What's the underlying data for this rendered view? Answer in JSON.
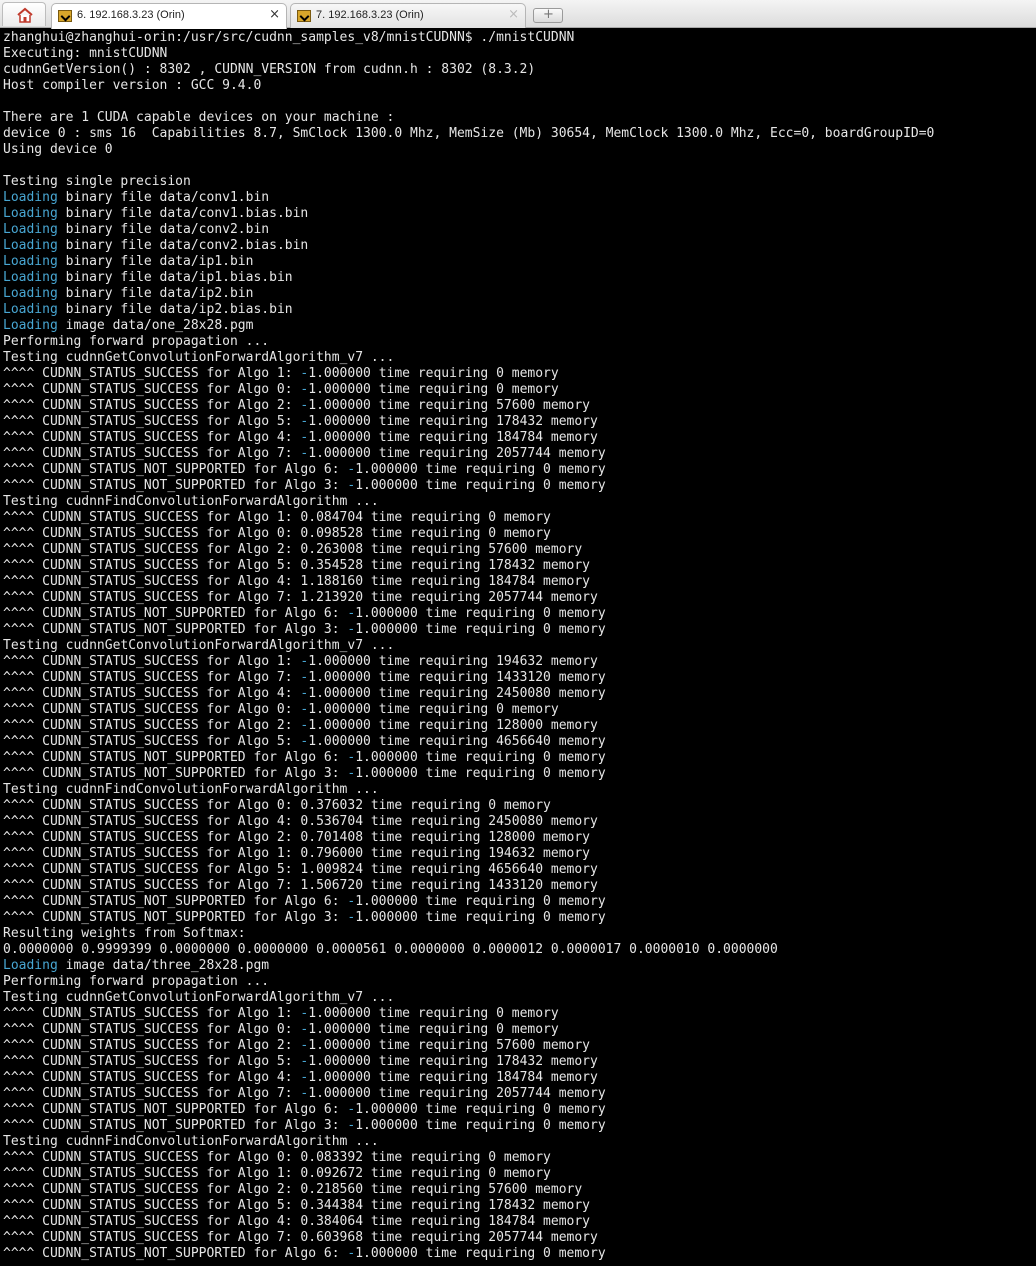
{
  "tabs": [
    {
      "label": "6. 192.168.3.23 (Orin)",
      "close": "×",
      "active": true
    },
    {
      "label": "7. 192.168.3.23 (Orin)",
      "close": "×",
      "active": false
    }
  ],
  "new_tab_symbol": "+",
  "colors": {
    "terminal_bg": "#000000",
    "terminal_fg": "#e6e6e6",
    "highlight": "#48a6d2"
  },
  "terminal": {
    "lines": [
      {
        "t": "zhanghui@zhanghui-orin:/usr/src/cudnn_samples_v8/mnistCUDNN$ ./mnistCUDNN"
      },
      {
        "t": "Executing: mnistCUDNN"
      },
      {
        "t": "cudnnGetVersion() : 8302 , CUDNN_VERSION from cudnn.h : 8302 (8.3.2)"
      },
      {
        "t": "Host compiler version : GCC 9.4.0"
      },
      {
        "t": ""
      },
      {
        "t": "There are 1 CUDA capable devices on your machine :"
      },
      {
        "t": "device 0 : sms 16  Capabilities 8.7, SmClock 1300.0 Mhz, MemSize (Mb) 30654, MemClock 1300.0 Mhz, Ecc=0, boardGroupID=0"
      },
      {
        "t": "Using device 0"
      },
      {
        "t": ""
      },
      {
        "t": "Testing single precision"
      },
      {
        "a": "Loading",
        "b": " binary file data/conv1.bin"
      },
      {
        "a": "Loading",
        "b": " binary file data/conv1.bias.bin"
      },
      {
        "a": "Loading",
        "b": " binary file data/conv2.bin"
      },
      {
        "a": "Loading",
        "b": " binary file data/conv2.bias.bin"
      },
      {
        "a": "Loading",
        "b": " binary file data/ip1.bin"
      },
      {
        "a": "Loading",
        "b": " binary file data/ip1.bias.bin"
      },
      {
        "a": "Loading",
        "b": " binary file data/ip2.bin"
      },
      {
        "a": "Loading",
        "b": " binary file data/ip2.bias.bin"
      },
      {
        "a": "Loading",
        "b": " image data/one_28x28.pgm"
      },
      {
        "t": "Performing forward propagation ..."
      },
      {
        "t": "Testing cudnnGetConvolutionForwardAlgorithm_v7 ..."
      },
      {
        "p": "^^^^ CUDNN_STATUS_SUCCESS for Algo 1: ",
        "h": "-",
        "s": "1.000000 time requiring 0 memory"
      },
      {
        "p": "^^^^ CUDNN_STATUS_SUCCESS for Algo 0: ",
        "h": "-",
        "s": "1.000000 time requiring 0 memory"
      },
      {
        "p": "^^^^ CUDNN_STATUS_SUCCESS for Algo 2: ",
        "h": "-",
        "s": "1.000000 time requiring 57600 memory"
      },
      {
        "p": "^^^^ CUDNN_STATUS_SUCCESS for Algo 5: ",
        "h": "-",
        "s": "1.000000 time requiring 178432 memory"
      },
      {
        "p": "^^^^ CUDNN_STATUS_SUCCESS for Algo 4: ",
        "h": "-",
        "s": "1.000000 time requiring 184784 memory"
      },
      {
        "p": "^^^^ CUDNN_STATUS_SUCCESS for Algo 7: ",
        "h": "-",
        "s": "1.000000 time requiring 2057744 memory"
      },
      {
        "p": "^^^^ CUDNN_STATUS_NOT_SUPPORTED for Algo 6: ",
        "h": "-",
        "s": "1.000000 time requiring 0 memory"
      },
      {
        "p": "^^^^ CUDNN_STATUS_NOT_SUPPORTED for Algo 3: ",
        "h": "-",
        "s": "1.000000 time requiring 0 memory"
      },
      {
        "t": "Testing cudnnFindConvolutionForwardAlgorithm ..."
      },
      {
        "t": "^^^^ CUDNN_STATUS_SUCCESS for Algo 1: 0.084704 time requiring 0 memory"
      },
      {
        "t": "^^^^ CUDNN_STATUS_SUCCESS for Algo 0: 0.098528 time requiring 0 memory"
      },
      {
        "t": "^^^^ CUDNN_STATUS_SUCCESS for Algo 2: 0.263008 time requiring 57600 memory"
      },
      {
        "t": "^^^^ CUDNN_STATUS_SUCCESS for Algo 5: 0.354528 time requiring 178432 memory"
      },
      {
        "t": "^^^^ CUDNN_STATUS_SUCCESS for Algo 4: 1.188160 time requiring 184784 memory"
      },
      {
        "t": "^^^^ CUDNN_STATUS_SUCCESS for Algo 7: 1.213920 time requiring 2057744 memory"
      },
      {
        "p": "^^^^ CUDNN_STATUS_NOT_SUPPORTED for Algo 6: ",
        "h": "-",
        "s": "1.000000 time requiring 0 memory"
      },
      {
        "p": "^^^^ CUDNN_STATUS_NOT_SUPPORTED for Algo 3: ",
        "h": "-",
        "s": "1.000000 time requiring 0 memory"
      },
      {
        "t": "Testing cudnnGetConvolutionForwardAlgorithm_v7 ..."
      },
      {
        "p": "^^^^ CUDNN_STATUS_SUCCESS for Algo 1: ",
        "h": "-",
        "s": "1.000000 time requiring 194632 memory"
      },
      {
        "p": "^^^^ CUDNN_STATUS_SUCCESS for Algo 7: ",
        "h": "-",
        "s": "1.000000 time requiring 1433120 memory"
      },
      {
        "p": "^^^^ CUDNN_STATUS_SUCCESS for Algo 4: ",
        "h": "-",
        "s": "1.000000 time requiring 2450080 memory"
      },
      {
        "p": "^^^^ CUDNN_STATUS_SUCCESS for Algo 0: ",
        "h": "-",
        "s": "1.000000 time requiring 0 memory"
      },
      {
        "p": "^^^^ CUDNN_STATUS_SUCCESS for Algo 2: ",
        "h": "-",
        "s": "1.000000 time requiring 128000 memory"
      },
      {
        "p": "^^^^ CUDNN_STATUS_SUCCESS for Algo 5: ",
        "h": "-",
        "s": "1.000000 time requiring 4656640 memory"
      },
      {
        "p": "^^^^ CUDNN_STATUS_NOT_SUPPORTED for Algo 6: ",
        "h": "-",
        "s": "1.000000 time requiring 0 memory"
      },
      {
        "p": "^^^^ CUDNN_STATUS_NOT_SUPPORTED for Algo 3: ",
        "h": "-",
        "s": "1.000000 time requiring 0 memory"
      },
      {
        "t": "Testing cudnnFindConvolutionForwardAlgorithm ..."
      },
      {
        "t": "^^^^ CUDNN_STATUS_SUCCESS for Algo 0: 0.376032 time requiring 0 memory"
      },
      {
        "t": "^^^^ CUDNN_STATUS_SUCCESS for Algo 4: 0.536704 time requiring 2450080 memory"
      },
      {
        "t": "^^^^ CUDNN_STATUS_SUCCESS for Algo 2: 0.701408 time requiring 128000 memory"
      },
      {
        "t": "^^^^ CUDNN_STATUS_SUCCESS for Algo 1: 0.796000 time requiring 194632 memory"
      },
      {
        "t": "^^^^ CUDNN_STATUS_SUCCESS for Algo 5: 1.009824 time requiring 4656640 memory"
      },
      {
        "t": "^^^^ CUDNN_STATUS_SUCCESS for Algo 7: 1.506720 time requiring 1433120 memory"
      },
      {
        "p": "^^^^ CUDNN_STATUS_NOT_SUPPORTED for Algo 6: ",
        "h": "-",
        "s": "1.000000 time requiring 0 memory"
      },
      {
        "p": "^^^^ CUDNN_STATUS_NOT_SUPPORTED for Algo 3: ",
        "h": "-",
        "s": "1.000000 time requiring 0 memory"
      },
      {
        "t": "Resulting weights from Softmax:"
      },
      {
        "t": "0.0000000 0.9999399 0.0000000 0.0000000 0.0000561 0.0000000 0.0000012 0.0000017 0.0000010 0.0000000"
      },
      {
        "a": "Loading",
        "b": " image data/three_28x28.pgm"
      },
      {
        "t": "Performing forward propagation ..."
      },
      {
        "t": "Testing cudnnGetConvolutionForwardAlgorithm_v7 ..."
      },
      {
        "p": "^^^^ CUDNN_STATUS_SUCCESS for Algo 1: ",
        "h": "-",
        "s": "1.000000 time requiring 0 memory"
      },
      {
        "p": "^^^^ CUDNN_STATUS_SUCCESS for Algo 0: ",
        "h": "-",
        "s": "1.000000 time requiring 0 memory"
      },
      {
        "p": "^^^^ CUDNN_STATUS_SUCCESS for Algo 2: ",
        "h": "-",
        "s": "1.000000 time requiring 57600 memory"
      },
      {
        "p": "^^^^ CUDNN_STATUS_SUCCESS for Algo 5: ",
        "h": "-",
        "s": "1.000000 time requiring 178432 memory"
      },
      {
        "p": "^^^^ CUDNN_STATUS_SUCCESS for Algo 4: ",
        "h": "-",
        "s": "1.000000 time requiring 184784 memory"
      },
      {
        "p": "^^^^ CUDNN_STATUS_SUCCESS for Algo 7: ",
        "h": "-",
        "s": "1.000000 time requiring 2057744 memory"
      },
      {
        "p": "^^^^ CUDNN_STATUS_NOT_SUPPORTED for Algo 6: ",
        "h": "-",
        "s": "1.000000 time requiring 0 memory"
      },
      {
        "p": "^^^^ CUDNN_STATUS_NOT_SUPPORTED for Algo 3: ",
        "h": "-",
        "s": "1.000000 time requiring 0 memory"
      },
      {
        "t": "Testing cudnnFindConvolutionForwardAlgorithm ..."
      },
      {
        "t": "^^^^ CUDNN_STATUS_SUCCESS for Algo 0: 0.083392 time requiring 0 memory"
      },
      {
        "t": "^^^^ CUDNN_STATUS_SUCCESS for Algo 1: 0.092672 time requiring 0 memory"
      },
      {
        "t": "^^^^ CUDNN_STATUS_SUCCESS for Algo 2: 0.218560 time requiring 57600 memory"
      },
      {
        "t": "^^^^ CUDNN_STATUS_SUCCESS for Algo 5: 0.344384 time requiring 178432 memory"
      },
      {
        "t": "^^^^ CUDNN_STATUS_SUCCESS for Algo 4: 0.384064 time requiring 184784 memory"
      },
      {
        "t": "^^^^ CUDNN_STATUS_SUCCESS for Algo 7: 0.603968 time requiring 2057744 memory"
      },
      {
        "p": "^^^^ CUDNN_STATUS_NOT_SUPPORTED for Algo 6: ",
        "h": "-",
        "s": "1.000000 time requiring 0 memory"
      }
    ]
  }
}
